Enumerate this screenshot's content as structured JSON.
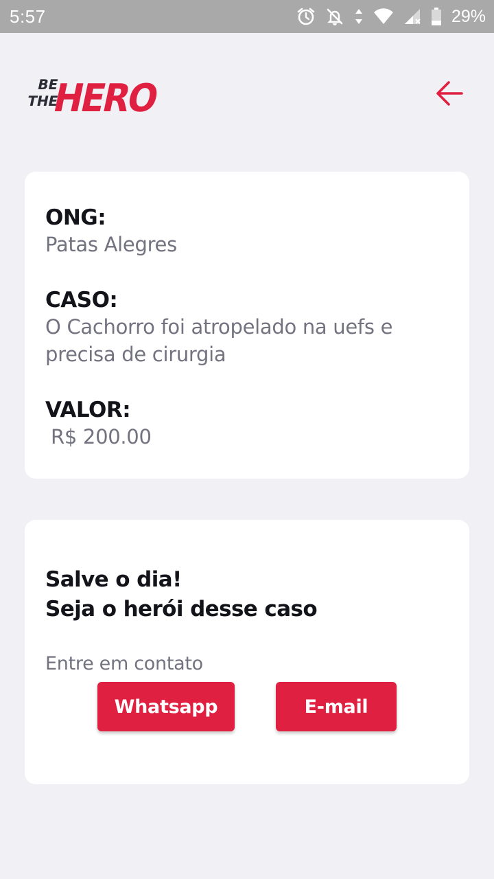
{
  "status_bar": {
    "time": "5:57",
    "battery": "29%",
    "icons": [
      "alarm-icon",
      "notifications-off-icon",
      "data-arrows-icon",
      "wifi-icon",
      "signal-icon",
      "battery-icon"
    ]
  },
  "header": {
    "logo_text": [
      "BE",
      "THE",
      "HERO"
    ],
    "back_icon": "arrow-left-icon"
  },
  "incident": {
    "ong_label": "ONG:",
    "ong_value": "Patas Alegres",
    "case_label": "CASO:",
    "case_value_line1": "O Cachorro foi atropelado na uefs e",
    "case_value_line2": "precisa de cirurgia",
    "value_label": "VALOR:",
    "value_amount": "R$ 200.00"
  },
  "contact": {
    "title_line1": "Salve o dia!",
    "title_line2": "Seja o herói desse caso",
    "description": "Entre em contato",
    "whatsapp_label": "Whatsapp",
    "email_label": "E-mail"
  },
  "colors": {
    "accent": "#e02041",
    "background": "#f0f0f5",
    "title_text": "#13131a",
    "muted_text": "#737380",
    "status_bar": "#a9a9a9"
  }
}
